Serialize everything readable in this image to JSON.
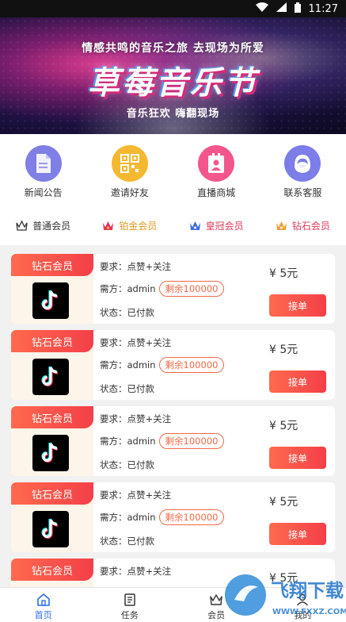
{
  "status_bar": {
    "time": "11:27"
  },
  "banner": {
    "subtitle": "情感共鸣的音乐之旅 去现场为所爱",
    "title": "草莓音乐节",
    "tagline": "音乐狂欢 嗨翻现场"
  },
  "menu": [
    {
      "label": "新闻公告",
      "icon": "document-icon",
      "color": "#7f7fe6"
    },
    {
      "label": "邀请好友",
      "icon": "qrcode-icon",
      "color": "#f5b830"
    },
    {
      "label": "直播商城",
      "icon": "person-card-icon",
      "color": "#f3568c"
    },
    {
      "label": "联系客服",
      "icon": "support-agent-icon",
      "color": "#7c7de8"
    }
  ],
  "tiers": [
    {
      "label": "普通会员",
      "color": "#333333"
    },
    {
      "label": "铂金会员",
      "color": "#e39a1f"
    },
    {
      "label": "皇冠会员",
      "color": "#e0385a"
    },
    {
      "label": "钻石会员",
      "color": "#e0385a"
    }
  ],
  "task_labels": {
    "requirement_prefix": "要求：",
    "buyer_prefix": "需方：",
    "status_prefix": "状态：",
    "accept_button": "接单"
  },
  "tasks": [
    {
      "badge": "钻石会员",
      "requirement": "点赞+关注",
      "buyer": "admin",
      "remaining": "剩余100000",
      "status": "已付款",
      "price": "¥ 5元"
    },
    {
      "badge": "钻石会员",
      "requirement": "点赞+关注",
      "buyer": "admin",
      "remaining": "剩余100000",
      "status": "已付款",
      "price": "¥ 5元"
    },
    {
      "badge": "钻石会员",
      "requirement": "点赞+关注",
      "buyer": "admin",
      "remaining": "剩余100000",
      "status": "已付款",
      "price": "¥ 5元"
    },
    {
      "badge": "钻石会员",
      "requirement": "点赞+关注",
      "buyer": "admin",
      "remaining": "剩余100000",
      "status": "已付款",
      "price": "¥ 5元"
    },
    {
      "badge": "钻石会员",
      "requirement": "点赞+关注",
      "price": "¥ 5元"
    }
  ],
  "bottom_nav": [
    {
      "label": "首页",
      "icon": "home-icon",
      "active": true
    },
    {
      "label": "任务",
      "icon": "task-list-icon",
      "active": false
    },
    {
      "label": "会员",
      "icon": "member-icon",
      "active": false
    },
    {
      "label": "我的",
      "icon": "profile-icon",
      "active": false
    }
  ],
  "watermark": {
    "brand": "飞翔下载",
    "url": "WWW.FXXZ.COM"
  },
  "colors": {
    "accent": "#f44d4a",
    "nav_active": "#2a6ee8"
  }
}
